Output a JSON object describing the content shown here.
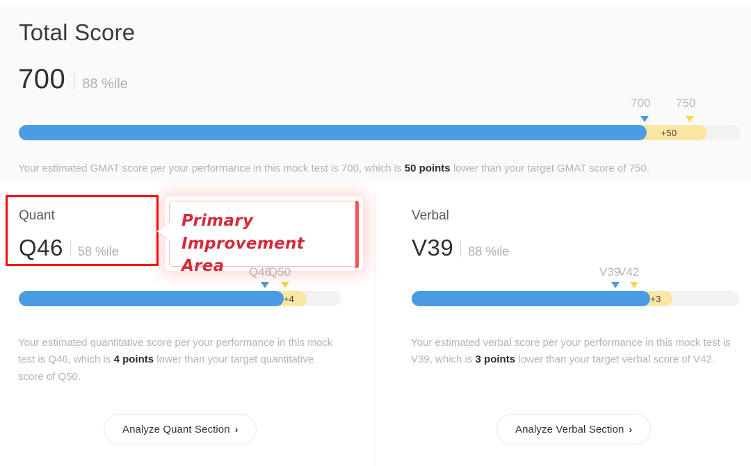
{
  "colors": {
    "blue": "#4c9ce4",
    "yellow": "#fbe6a3",
    "yellow_arrow": "#fcd451",
    "track": "#f2f2f2",
    "annotation_red": "#ff0000",
    "callout_text": "#d42a38",
    "panel_bg": "#fafafa"
  },
  "total": {
    "title": "Total Score",
    "score": "700",
    "percentile": "88 %ile",
    "tick_current": "700",
    "tick_target": "750",
    "gain_badge": "+50",
    "desc_pre": "Your estimated GMAT score per your performance in this mock test is 700, which is ",
    "desc_bold": "50 points",
    "desc_post": " lower than your target GMAT score of 750."
  },
  "quant": {
    "label": "Quant",
    "score": "Q46",
    "percentile": "58 %ile",
    "tick_current": "Q46",
    "tick_target": "Q50",
    "gain_badge": "+4",
    "desc_pre": "Your estimated quantitative score per your performance in this mock test is Q46, which is ",
    "desc_bold": "4 points",
    "desc_post": " lower than your target quantitative score of Q50.",
    "button": "Analyze Quant Section",
    "button_chevron": "›"
  },
  "verbal": {
    "label": "Verbal",
    "score": "V39",
    "percentile": "88 %ile",
    "tick_current": "V39",
    "tick_target": "V42",
    "gain_badge": "+3",
    "desc_pre": "Your estimated verbal score per your performance in this mock test is V39, which is ",
    "desc_bold": "3 points",
    "desc_post": " lower than your target verbal score of V42.",
    "button": "Analyze Verbal Section",
    "button_chevron": "›"
  },
  "annotation": {
    "callout_line1": "Primary",
    "callout_line2": "Improvement Area"
  },
  "chart_data": [
    {
      "type": "bar",
      "title": "Total Score",
      "orientation": "horizontal-progress",
      "current_value": 700,
      "target_value": 750,
      "gap": 50,
      "percentile": 88,
      "axis_min": 200,
      "axis_max": 800,
      "segments": [
        {
          "name": "achieved",
          "value": 700,
          "color": "#4c9ce4"
        },
        {
          "name": "gap-to-target",
          "value": 50,
          "color": "#fbe6a3",
          "label": "+50"
        },
        {
          "name": "remaining",
          "value": 50,
          "color": "#f2f2f2"
        }
      ],
      "markers": [
        {
          "label": "700",
          "value": 700,
          "color": "#4c9ce4"
        },
        {
          "label": "750",
          "value": 750,
          "color": "#fcd451"
        }
      ]
    },
    {
      "type": "bar",
      "title": "Quant",
      "orientation": "horizontal-progress",
      "current_value": 46,
      "target_value": 50,
      "gap": 4,
      "percentile": 58,
      "axis_min": 6,
      "axis_max": 51,
      "segments": [
        {
          "name": "achieved",
          "value": 46,
          "color": "#4c9ce4"
        },
        {
          "name": "gap-to-target",
          "value": 4,
          "color": "#fbe6a3",
          "label": "+4"
        },
        {
          "name": "remaining",
          "value": 1,
          "color": "#f2f2f2"
        }
      ],
      "markers": [
        {
          "label": "Q46",
          "value": 46,
          "color": "#4c9ce4"
        },
        {
          "label": "Q50",
          "value": 50,
          "color": "#fcd451"
        }
      ]
    },
    {
      "type": "bar",
      "title": "Verbal",
      "orientation": "horizontal-progress",
      "current_value": 39,
      "target_value": 42,
      "gap": 3,
      "percentile": 88,
      "axis_min": 6,
      "axis_max": 51,
      "segments": [
        {
          "name": "achieved",
          "value": 39,
          "color": "#4c9ce4"
        },
        {
          "name": "gap-to-target",
          "value": 3,
          "color": "#fbe6a3",
          "label": "+3"
        },
        {
          "name": "remaining",
          "value": 9,
          "color": "#f2f2f2"
        }
      ],
      "markers": [
        {
          "label": "V39",
          "value": 39,
          "color": "#4c9ce4"
        },
        {
          "label": "V42",
          "value": 42,
          "color": "#fcd451"
        }
      ]
    }
  ]
}
